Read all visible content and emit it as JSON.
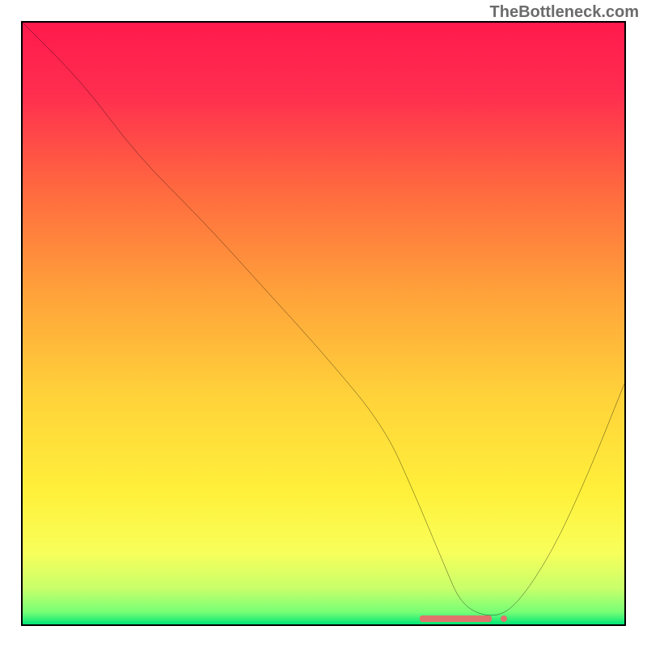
{
  "attribution": "TheBottleneck.com",
  "chart_data": {
    "type": "line",
    "title": "",
    "xlabel": "",
    "ylabel": "",
    "xlim": [
      0,
      100
    ],
    "ylim": [
      0,
      100
    ],
    "series": [
      {
        "name": "bottleneck-curve",
        "x": [
          0,
          10,
          19,
          30,
          40,
          50,
          60,
          65,
          70,
          73,
          78,
          82,
          88,
          94,
          100
        ],
        "values": [
          100,
          90,
          78,
          67,
          56,
          45,
          33,
          22,
          10,
          3,
          1,
          3,
          12,
          25,
          40
        ]
      }
    ],
    "gradient_stops": [
      {
        "pos": 0.0,
        "color": "#ff1a4d"
      },
      {
        "pos": 0.12,
        "color": "#ff2e4f"
      },
      {
        "pos": 0.28,
        "color": "#ff6a3f"
      },
      {
        "pos": 0.45,
        "color": "#ffa23a"
      },
      {
        "pos": 0.62,
        "color": "#ffd23a"
      },
      {
        "pos": 0.78,
        "color": "#fff03a"
      },
      {
        "pos": 0.88,
        "color": "#f8ff5a"
      },
      {
        "pos": 0.94,
        "color": "#c8ff6a"
      },
      {
        "pos": 0.98,
        "color": "#76ff76"
      },
      {
        "pos": 1.0,
        "color": "#00e676"
      }
    ],
    "marker": {
      "x_start": 66,
      "x_end": 78,
      "y": 1
    },
    "marker_dot": {
      "x": 80,
      "y": 1
    }
  }
}
